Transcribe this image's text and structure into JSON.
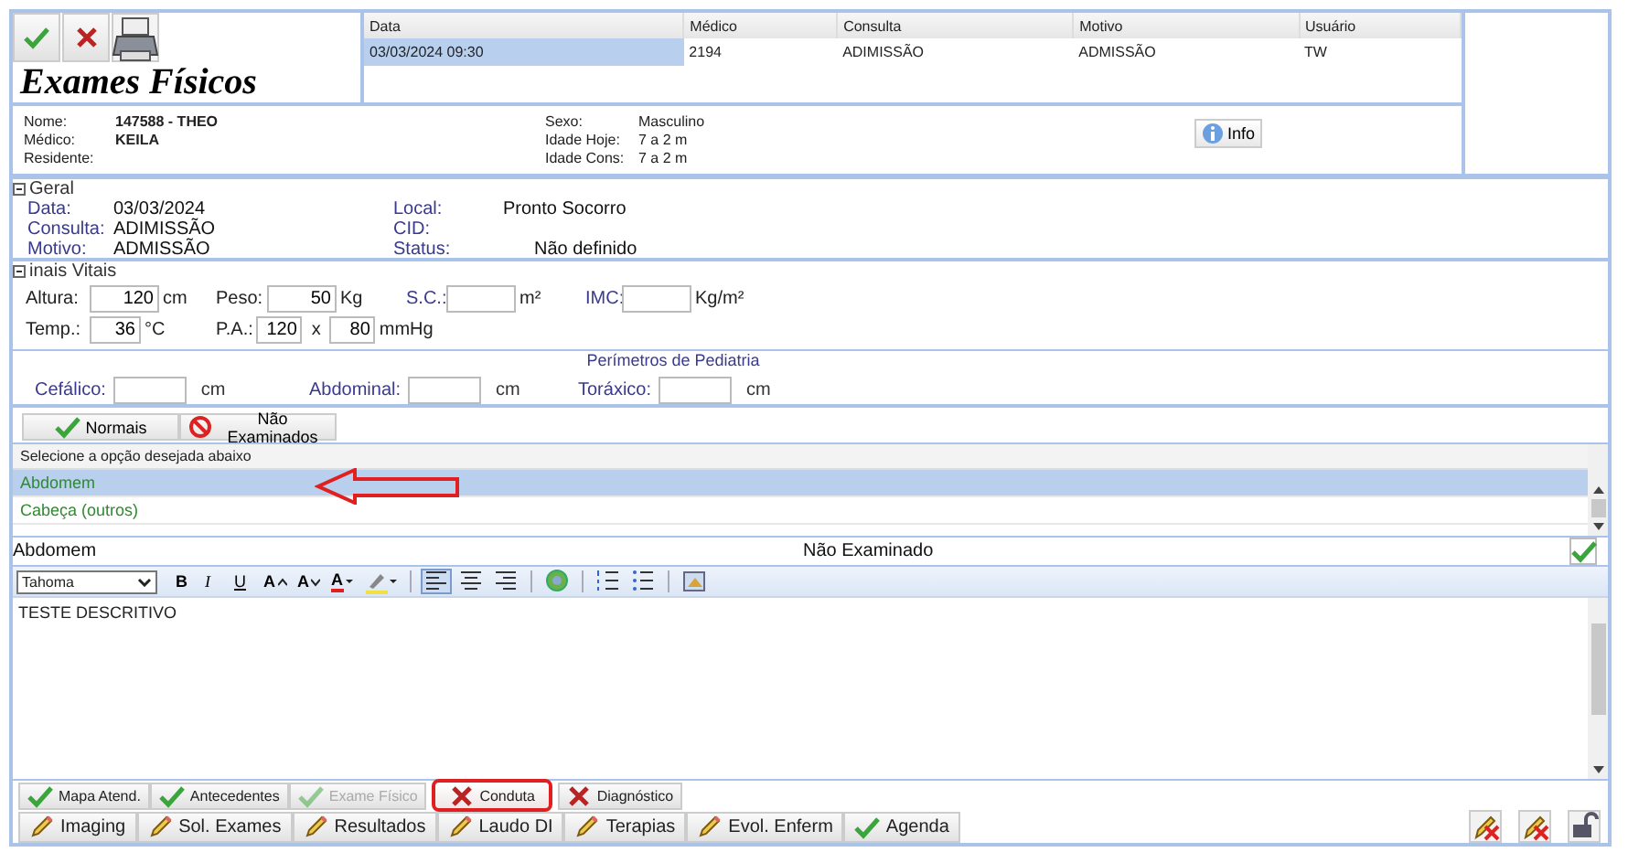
{
  "title": "Exames Físicos",
  "records": {
    "columns": [
      "Data",
      "Médico",
      "Consulta",
      "Motivo",
      "Usuário"
    ],
    "rows": [
      {
        "cells": [
          "03/03/2024 09:30",
          "2194",
          "ADIMISSÃO",
          "ADMISSÃO",
          "TW"
        ],
        "selected": true
      }
    ]
  },
  "patient": {
    "left": [
      {
        "label": "Nome:",
        "value": "147588 - THEO"
      },
      {
        "label": "Médico:",
        "value": "KEILA"
      },
      {
        "label": "Residente:"
      }
    ],
    "right": [
      {
        "label": "Sexo:",
        "value": "Masculino"
      },
      {
        "label": "Idade Hoje:",
        "value": "7 a 2 m"
      },
      {
        "label": "Idade Cons:",
        "value": "7 a 2 m"
      }
    ],
    "info_button": "Info"
  },
  "geral": {
    "title": "Geral",
    "expanded": true,
    "left": [
      {
        "label": "Data:",
        "value": "03/03/2024"
      },
      {
        "label": "Consulta:",
        "value": "ADIMISSÃO"
      },
      {
        "label": "Motivo:",
        "value": "ADMISSÃO"
      }
    ],
    "right": [
      {
        "label": "Local:",
        "value": "Pronto Socorro"
      },
      {
        "label": "CID:"
      },
      {
        "label": "Status:",
        "value": "Não definido"
      }
    ]
  },
  "vitals": {
    "title": "inais Vitais",
    "expanded": true,
    "rows": [
      [
        {
          "label": "Altura:",
          "values": [
            "120"
          ],
          "unit": "cm"
        },
        {
          "label": "Peso:",
          "values": [
            "50"
          ],
          "unit": "Kg"
        },
        {
          "label": "S.C.:",
          "unit": "m²"
        },
        {
          "label": "IMC:",
          "unit": "Kg/m²"
        }
      ],
      [
        {
          "label": "Temp.:",
          "values": [
            "36"
          ],
          "unit": "°C"
        },
        {
          "label": "P.A.:",
          "values": [
            "120",
            "80"
          ],
          "separator": "x",
          "unit": "mmHg"
        }
      ]
    ]
  },
  "perimeters": {
    "title": "Perímetros de Pediatria",
    "fields": [
      {
        "label": "Cefálico:",
        "unit": "cm"
      },
      {
        "label": "Abdominal:",
        "unit": "cm"
      },
      {
        "label": "Toráxico:",
        "unit": "cm"
      }
    ]
  },
  "actions": [
    {
      "label": "Normais",
      "kind": "check"
    },
    {
      "label": "Não Examinados",
      "kind": "forbid"
    }
  ],
  "exam_list": {
    "header": "Selecione a opção desejada abaixo",
    "items": [
      {
        "label": "Abdomem",
        "selected": true
      },
      {
        "label": "Cabeça (outros)",
        "selected": false
      }
    ]
  },
  "selected_exam": {
    "name": "Abdomem",
    "status": "Não Examinado",
    "confirmed": true
  },
  "editor": {
    "font": "Tahoma",
    "tools": [
      {
        "kind": "bold",
        "label": "B"
      },
      {
        "kind": "italic",
        "label": "I"
      },
      {
        "kind": "underline",
        "label": "U"
      },
      {
        "kind": "grow",
        "label": "A"
      },
      {
        "kind": "shrink",
        "label": "A"
      },
      {
        "kind": "color",
        "label": "A"
      },
      {
        "kind": "highlight"
      },
      {
        "kind": "sep"
      },
      {
        "kind": "align-left",
        "selected": true
      },
      {
        "kind": "align-center",
        "selected": false
      },
      {
        "kind": "align-right",
        "selected": false
      },
      {
        "kind": "sep"
      },
      {
        "kind": "globe"
      },
      {
        "kind": "sep"
      },
      {
        "kind": "ordered-list"
      },
      {
        "kind": "bullet-list"
      },
      {
        "kind": "sep"
      },
      {
        "kind": "image"
      }
    ],
    "text": "TESTE DESCRITIVO"
  },
  "tabs_row1": [
    {
      "label": "Mapa Atend.",
      "kind": "check",
      "disabled": false,
      "highlighted": false
    },
    {
      "label": "Antecedentes",
      "kind": "check",
      "disabled": false,
      "highlighted": false
    },
    {
      "label": "Exame Físico",
      "kind": "check",
      "disabled": true,
      "highlighted": false
    },
    {
      "label": "Conduta",
      "kind": "cross",
      "disabled": false,
      "highlighted": true
    },
    {
      "label": "Diagnóstico",
      "kind": "cross",
      "disabled": false,
      "highlighted": false
    }
  ],
  "tabs_row2": [
    {
      "label": "Imaging",
      "kind": "pencil"
    },
    {
      "label": "Sol. Exames",
      "kind": "pencil"
    },
    {
      "label": "Resultados",
      "kind": "pencil"
    },
    {
      "label": "Laudo DI",
      "kind": "pencil"
    },
    {
      "label": "Terapias",
      "kind": "pencil"
    },
    {
      "label": "Evol. Enferm",
      "kind": "pencil"
    },
    {
      "label": "Agenda",
      "kind": "check"
    }
  ]
}
